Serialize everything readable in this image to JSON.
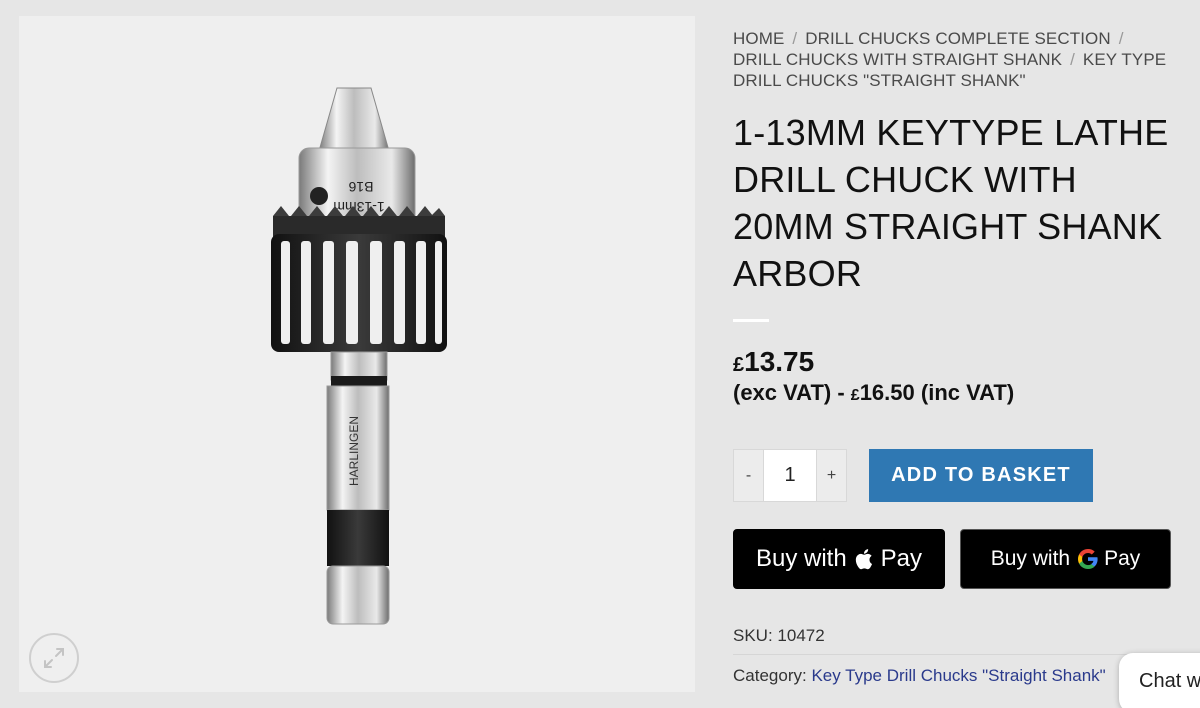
{
  "breadcrumb": {
    "items": [
      {
        "label": "HOME"
      },
      {
        "label": "DRILL CHUCKS COMPLETE SECTION"
      },
      {
        "label": "DRILL CHUCKS WITH STRAIGHT SHANK"
      },
      {
        "label": "KEY TYPE DRILL CHUCKS \"STRAIGHT SHANK\""
      }
    ],
    "separator": "/"
  },
  "product": {
    "title": "1-13MM KEYTYPE LATHE DRILL CHUCK WITH 20MM STRAIGHT SHANK ARBOR",
    "image_labels": {
      "chuck_size": "1-13mm",
      "taper": "B16",
      "brand": "HARLINGEN"
    },
    "price": {
      "currency_symbol": "£",
      "exc_vat": "13.75",
      "exc_label": "(exc VAT) -",
      "inc_vat": "16.50",
      "inc_label": "(inc VAT)"
    },
    "quantity": {
      "minus": "-",
      "value": "1",
      "plus": "+"
    },
    "add_to_basket": "ADD TO BASKET",
    "apple_pay": {
      "prefix": "Buy with",
      "word": "Pay"
    },
    "google_pay": {
      "prefix": "Buy with",
      "word": "Pay"
    },
    "sku": {
      "label": "SKU:",
      "value": "10472"
    },
    "category": {
      "label": "Category:",
      "value": "Key Type Drill Chucks \"Straight Shank\""
    }
  },
  "icons": {
    "zoom": "expand-arrows-icon",
    "apple": "apple-logo-icon",
    "google": "google-g-icon"
  },
  "colors": {
    "accent": "#2f78b3",
    "link": "#2a3a8c",
    "pay_bg": "#000000"
  },
  "chat": {
    "label": "Chat w"
  }
}
